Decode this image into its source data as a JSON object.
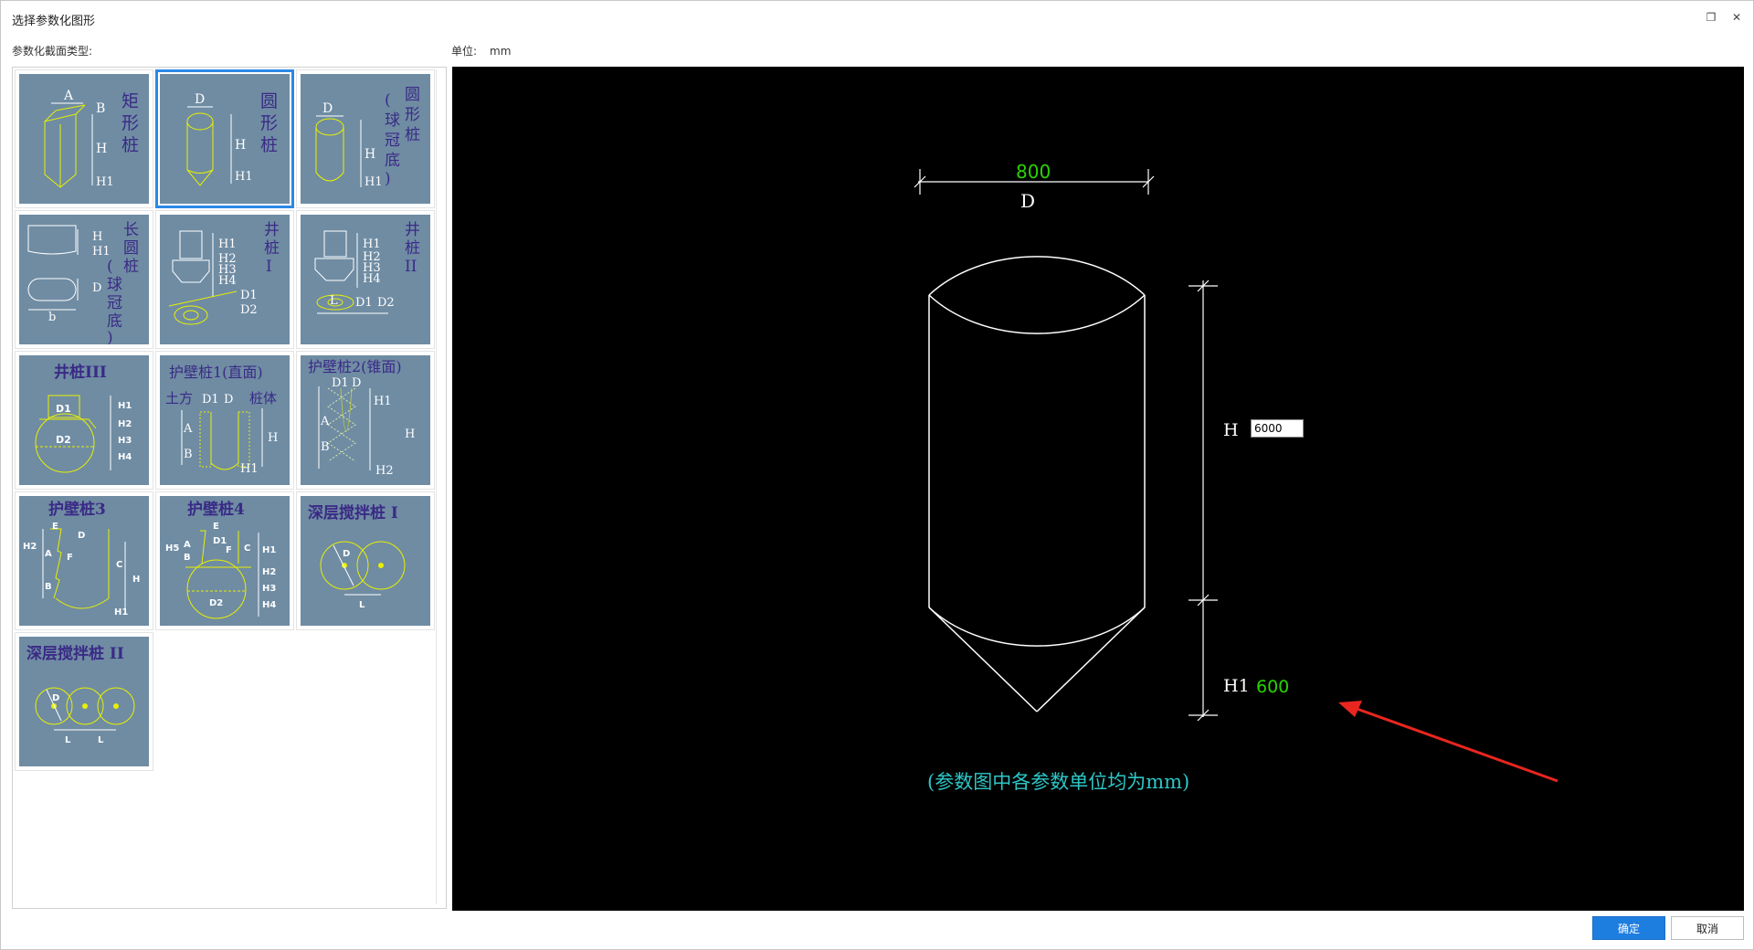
{
  "window": {
    "title": "选择参数化图形",
    "restore_icon": "restore-icon",
    "close_icon": "close-icon"
  },
  "labels": {
    "section_type": "参数化截面类型:",
    "unit_label": "单位:",
    "unit_value": "mm"
  },
  "tiles": [
    {
      "id": "rect-pile",
      "title": "矩形桩",
      "texts": [
        "A",
        "B",
        "H",
        "H1"
      ]
    },
    {
      "id": "round-pile",
      "title": "圆形桩",
      "texts": [
        "D",
        "H",
        "H1"
      ]
    },
    {
      "id": "round-pile-dome",
      "title": "圆形桩(球冠底)",
      "texts": [
        "D",
        "H",
        "H1"
      ]
    },
    {
      "id": "long-round-pile",
      "title": "长圆桩(球冠底)",
      "texts": [
        "H",
        "H1",
        "D",
        "b"
      ]
    },
    {
      "id": "well-pile-1",
      "title": "井桩I",
      "texts": [
        "H1",
        "H2",
        "H3",
        "H4",
        "D1",
        "D2"
      ]
    },
    {
      "id": "well-pile-2",
      "title": "井桩II",
      "texts": [
        "H1",
        "H2",
        "H3",
        "H4",
        "L",
        "D1",
        "D2"
      ]
    },
    {
      "id": "well-pile-3",
      "title": "井桩III",
      "texts": [
        "D1",
        "D2",
        "H1",
        "H2",
        "H3",
        "H4"
      ]
    },
    {
      "id": "wall-pile-1",
      "title": "护壁桩1(直面)",
      "texts": [
        "土方",
        "D1",
        "D",
        "桩体",
        "A",
        "B",
        "H",
        "H1"
      ]
    },
    {
      "id": "wall-pile-2",
      "title": "护壁桩2(锥面)",
      "texts": [
        "D1",
        "D",
        "H1",
        "A",
        "B",
        "H",
        "H2"
      ]
    },
    {
      "id": "wall-pile-3",
      "title": "护壁桩3",
      "texts": [
        "E",
        "D",
        "H2",
        "A",
        "F",
        "B",
        "C",
        "H",
        "H1"
      ]
    },
    {
      "id": "wall-pile-4",
      "title": "护壁桩4",
      "texts": [
        "E",
        "D1",
        "H5",
        "A",
        "B",
        "F",
        "C",
        "H1",
        "H2",
        "H3",
        "H4",
        "D2"
      ]
    },
    {
      "id": "deep-mix-1",
      "title": "深层搅拌桩 I",
      "texts": [
        "D",
        "L"
      ]
    },
    {
      "id": "deep-mix-2",
      "title": "深层搅拌桩 II",
      "texts": [
        "D",
        "L",
        "L"
      ]
    }
  ],
  "selected_tile": "round-pile",
  "drawing": {
    "d_value": "800",
    "d_label": "D",
    "h_label": "H",
    "h_value": "6000",
    "h1_label": "H1",
    "h1_value": "600",
    "note": "(参数图中各参数单位均为mm)"
  },
  "buttons": {
    "ok": "确定",
    "cancel": "取消"
  },
  "colors": {
    "tile_bg": "#6f8ca3",
    "title_purple": "#3a2a86",
    "line_yellow": "#e8f000",
    "green_value": "#2ad400",
    "cyan_note": "#2fc6c6",
    "selected_border": "#2c88e6",
    "ok_blue": "#1e7ee0",
    "arrow_red": "#e8261f"
  }
}
